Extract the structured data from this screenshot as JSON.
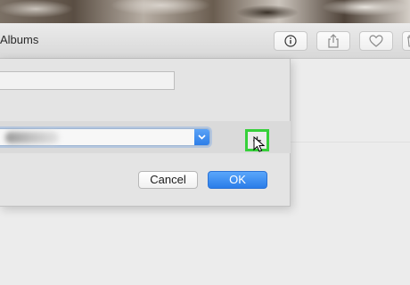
{
  "window": {
    "title": "Albums"
  },
  "toolbar": {
    "buttons": [
      {
        "icon": "info-icon"
      },
      {
        "icon": "share-icon"
      },
      {
        "icon": "heart-icon"
      },
      {
        "icon": "trash-icon"
      }
    ]
  },
  "dialog": {
    "name_field": {
      "value": "",
      "placeholder": ""
    },
    "album_select": {
      "value": ""
    },
    "add_button_label": "+",
    "cancel_label": "Cancel",
    "ok_label": "OK"
  },
  "colors": {
    "accent": "#2d7ee8",
    "highlight": "#36d03a"
  }
}
